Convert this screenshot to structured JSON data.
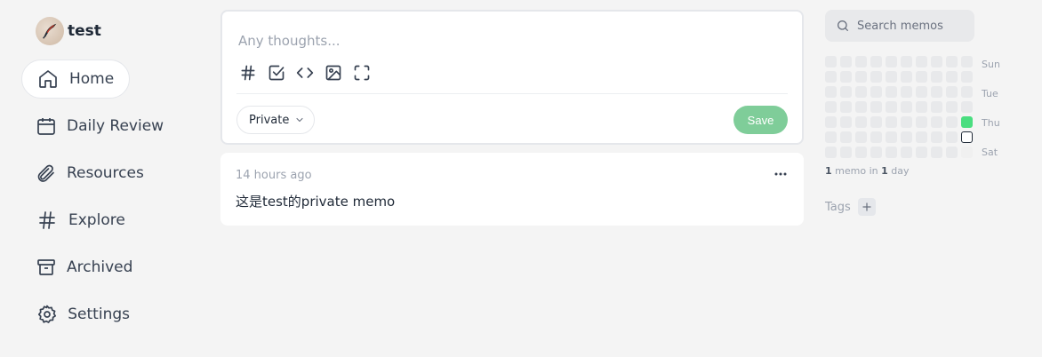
{
  "user": {
    "name": "test",
    "avatar_icon": "feather-avatar-icon"
  },
  "nav": [
    {
      "label": "Home",
      "icon": "home-icon",
      "active": true
    },
    {
      "label": "Daily Review",
      "icon": "calendar-icon",
      "active": false
    },
    {
      "label": "Resources",
      "icon": "paperclip-icon",
      "active": false
    },
    {
      "label": "Explore",
      "icon": "hash-icon",
      "active": false
    },
    {
      "label": "Archived",
      "icon": "archive-icon",
      "active": false
    },
    {
      "label": "Settings",
      "icon": "gear-icon",
      "active": false
    }
  ],
  "editor": {
    "placeholder": "Any thoughts...",
    "toolbar": [
      "hash-icon",
      "checkbox-icon",
      "code-icon",
      "image-icon",
      "fullscreen-icon"
    ],
    "visibility": "Private",
    "save_label": "Save",
    "save_color": "#7fcd99"
  },
  "memo": {
    "time": "14 hours ago",
    "content": "这是test的private memo"
  },
  "search": {
    "placeholder": "Search memos"
  },
  "heatmap": {
    "day_labels": [
      "Sun",
      "Tue",
      "Thu",
      "Sat"
    ],
    "stat_count": "1",
    "stat_mid": " memo in ",
    "stat_days": "1",
    "stat_unit": " day",
    "active_color": "#4ade80"
  },
  "tags": {
    "label": "Tags"
  }
}
